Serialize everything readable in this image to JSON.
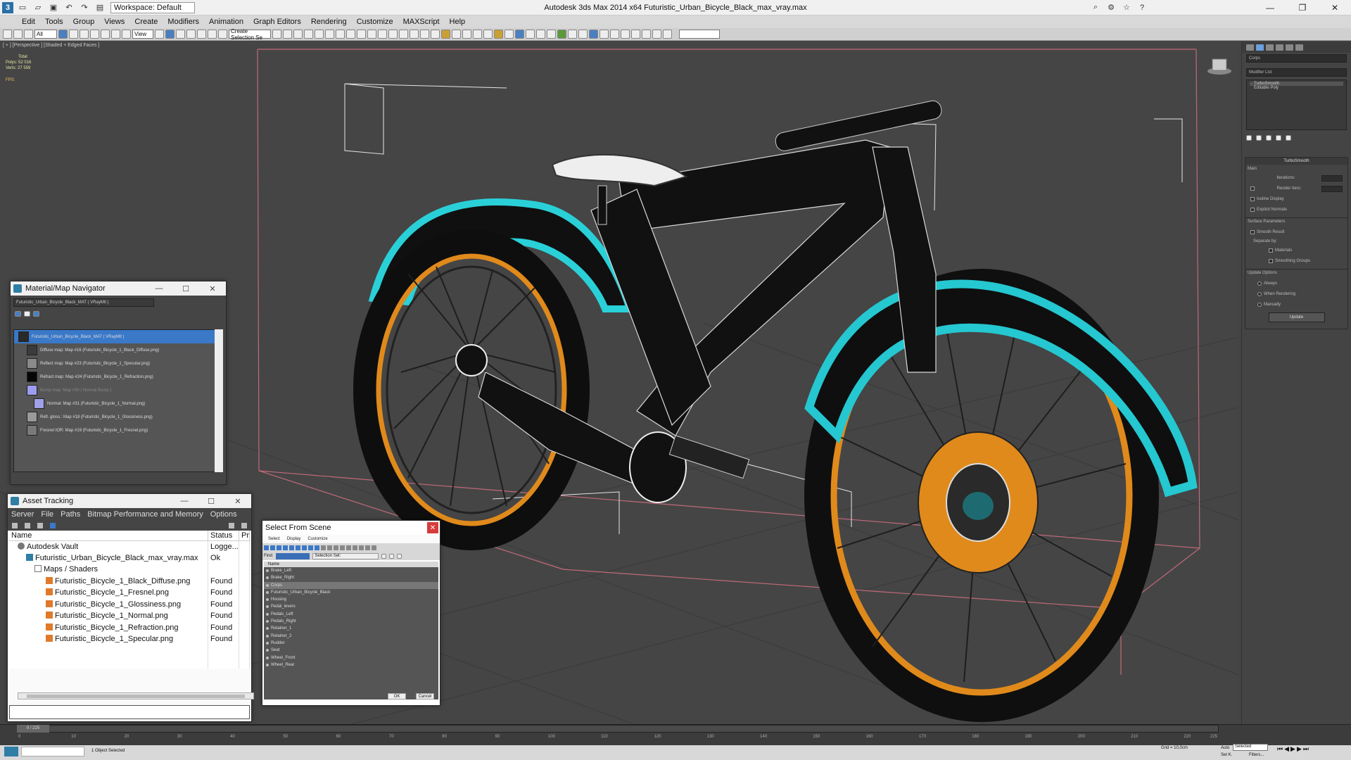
{
  "titlebar": {
    "workspace": "Workspace: Default",
    "app_title": "Autodesk 3ds Max  2014 x64      Futuristic_Urban_Bicycle_Black_max_vray.max"
  },
  "menus": [
    "Edit",
    "Tools",
    "Group",
    "Views",
    "Create",
    "Modifiers",
    "Animation",
    "Graph Editors",
    "Rendering",
    "Customize",
    "MAXScript",
    "Help"
  ],
  "toolbar": {
    "selection_filter": "All",
    "ref_coord": "View",
    "named_selection": "Create Selection Se"
  },
  "viewport": {
    "label": "[ + ] [Perspective ] [Shaded + Edged Faces ]",
    "stats_total": "Total",
    "polys_label": "Polys:",
    "polys_value": "52 016",
    "verts_label": "Verts:",
    "verts_value": "27 559",
    "fps_label": "FPS:"
  },
  "command_panel": {
    "object_name": "Corps",
    "modifier_list": "Modifier List",
    "stack": [
      "TurboSmooth",
      "Editable Poly"
    ],
    "turbosmooth_title": "TurboSmooth",
    "main_label": "Main",
    "iterations": "Iterations:",
    "render_iters": "Render Iters:",
    "isoline": "Isoline Display",
    "explicit_normals": "Explicit Normals",
    "surface_params": "Surface Parameters",
    "smooth_result": "Smooth Result",
    "separate_by": "Separate by:",
    "materials": "Materials",
    "smoothing_groups": "Smoothing Groups",
    "update_options": "Update Options",
    "always": "Always",
    "when_rendering": "When Rendering",
    "manually": "Manually",
    "update_btn": "Update"
  },
  "material_navigator": {
    "title": "Material/Map Navigator",
    "material_field": "Futuristic_Urban_Bicycle_Black_MAT ( VRayMtl )",
    "tree": [
      {
        "label": "Futuristic_Urban_Bicycle_Black_MAT ( VRayMtl )",
        "color": "#2a2a2a"
      },
      {
        "label": "Diffuse map: Map #16 (Futuristic_Bicycle_1_Black_Diffuse.png)",
        "color": "#3a3a3a"
      },
      {
        "label": "Reflect map: Map #23 (Futuristic_Bicycle_1_Specular.png)",
        "color": "#8a8a8a"
      },
      {
        "label": "Refract map: Map #24 (Futuristic_Bicycle_1_Refraction.png)",
        "color": "#050505"
      },
      {
        "label": "Bump map: Map #30 ( Normal Bump )",
        "color": "#9c9cf0"
      },
      {
        "label": "Normal: Map #31 (Futuristic_Bicycle_1_Normal.png)",
        "color": "#a0a0e8"
      },
      {
        "label": "Refl. gloss.: Map #18 (Futuristic_Bicycle_1_Glossiness.png)",
        "color": "#9a9a9a"
      },
      {
        "label": "Fresnel IOR: Map #19 (Futuristic_Bicycle_1_Fresnel.png)",
        "color": "#7a7a7a"
      }
    ]
  },
  "asset_tracking": {
    "title": "Asset Tracking",
    "menus": [
      "Server",
      "File",
      "Paths",
      "Bitmap Performance and Memory",
      "Options"
    ],
    "columns": {
      "name": "Name",
      "status": "Status",
      "pr": "Pr"
    },
    "rows": [
      {
        "name": "Autodesk Vault",
        "status": "Logge...",
        "indent": 0,
        "icon": "vault"
      },
      {
        "name": "Futuristic_Urban_Bicycle_Black_max_vray.max",
        "status": "Ok",
        "indent": 1,
        "icon": "max"
      },
      {
        "name": "Maps / Shaders",
        "status": "",
        "indent": 2,
        "icon": "folder"
      },
      {
        "name": "Futuristic_Bicycle_1_Black_Diffuse.png",
        "status": "Found",
        "indent": 3,
        "icon": "image"
      },
      {
        "name": "Futuristic_Bicycle_1_Fresnel.png",
        "status": "Found",
        "indent": 3,
        "icon": "image"
      },
      {
        "name": "Futuristic_Bicycle_1_Glossiness.png",
        "status": "Found",
        "indent": 3,
        "icon": "image"
      },
      {
        "name": "Futuristic_Bicycle_1_Normal.png",
        "status": "Found",
        "indent": 3,
        "icon": "image"
      },
      {
        "name": "Futuristic_Bicycle_1_Refraction.png",
        "status": "Found",
        "indent": 3,
        "icon": "image"
      },
      {
        "name": "Futuristic_Bicycle_1_Specular.png",
        "status": "Found",
        "indent": 3,
        "icon": "image"
      }
    ]
  },
  "select_from_scene": {
    "title": "Select From Scene",
    "menus": [
      "Select",
      "Display",
      "Customize"
    ],
    "find_label": "Find:",
    "selection_set": "Selection Set:",
    "list_header": "Name",
    "items": [
      "Brake_Left",
      "Brake_Right",
      "Corps",
      "Futuristic_Urban_Bicycle_Black",
      "Housing",
      "Pedal_levers",
      "Pedals_Left",
      "Pedals_Right",
      "Retainer_1",
      "Retainer_2",
      "Rudder",
      "Seat",
      "Wheel_Front",
      "Wheel_Rear"
    ],
    "selected_item": "Corps",
    "ok": "OK",
    "cancel": "Cancel"
  },
  "timeline": {
    "frame": "0 / 225",
    "ticks": [
      "0",
      "10",
      "20",
      "30",
      "40",
      "50",
      "60",
      "70",
      "80",
      "90",
      "100",
      "110",
      "120",
      "130",
      "140",
      "150",
      "160",
      "170",
      "180",
      "190",
      "200",
      "210",
      "220",
      "225"
    ]
  },
  "statusbar": {
    "objects": "1 Object Selected",
    "grid": "Grid = 10,0cm",
    "auto": "Auto",
    "selected": "Selected",
    "set_key": "Set K.",
    "filters": "Filters..."
  }
}
